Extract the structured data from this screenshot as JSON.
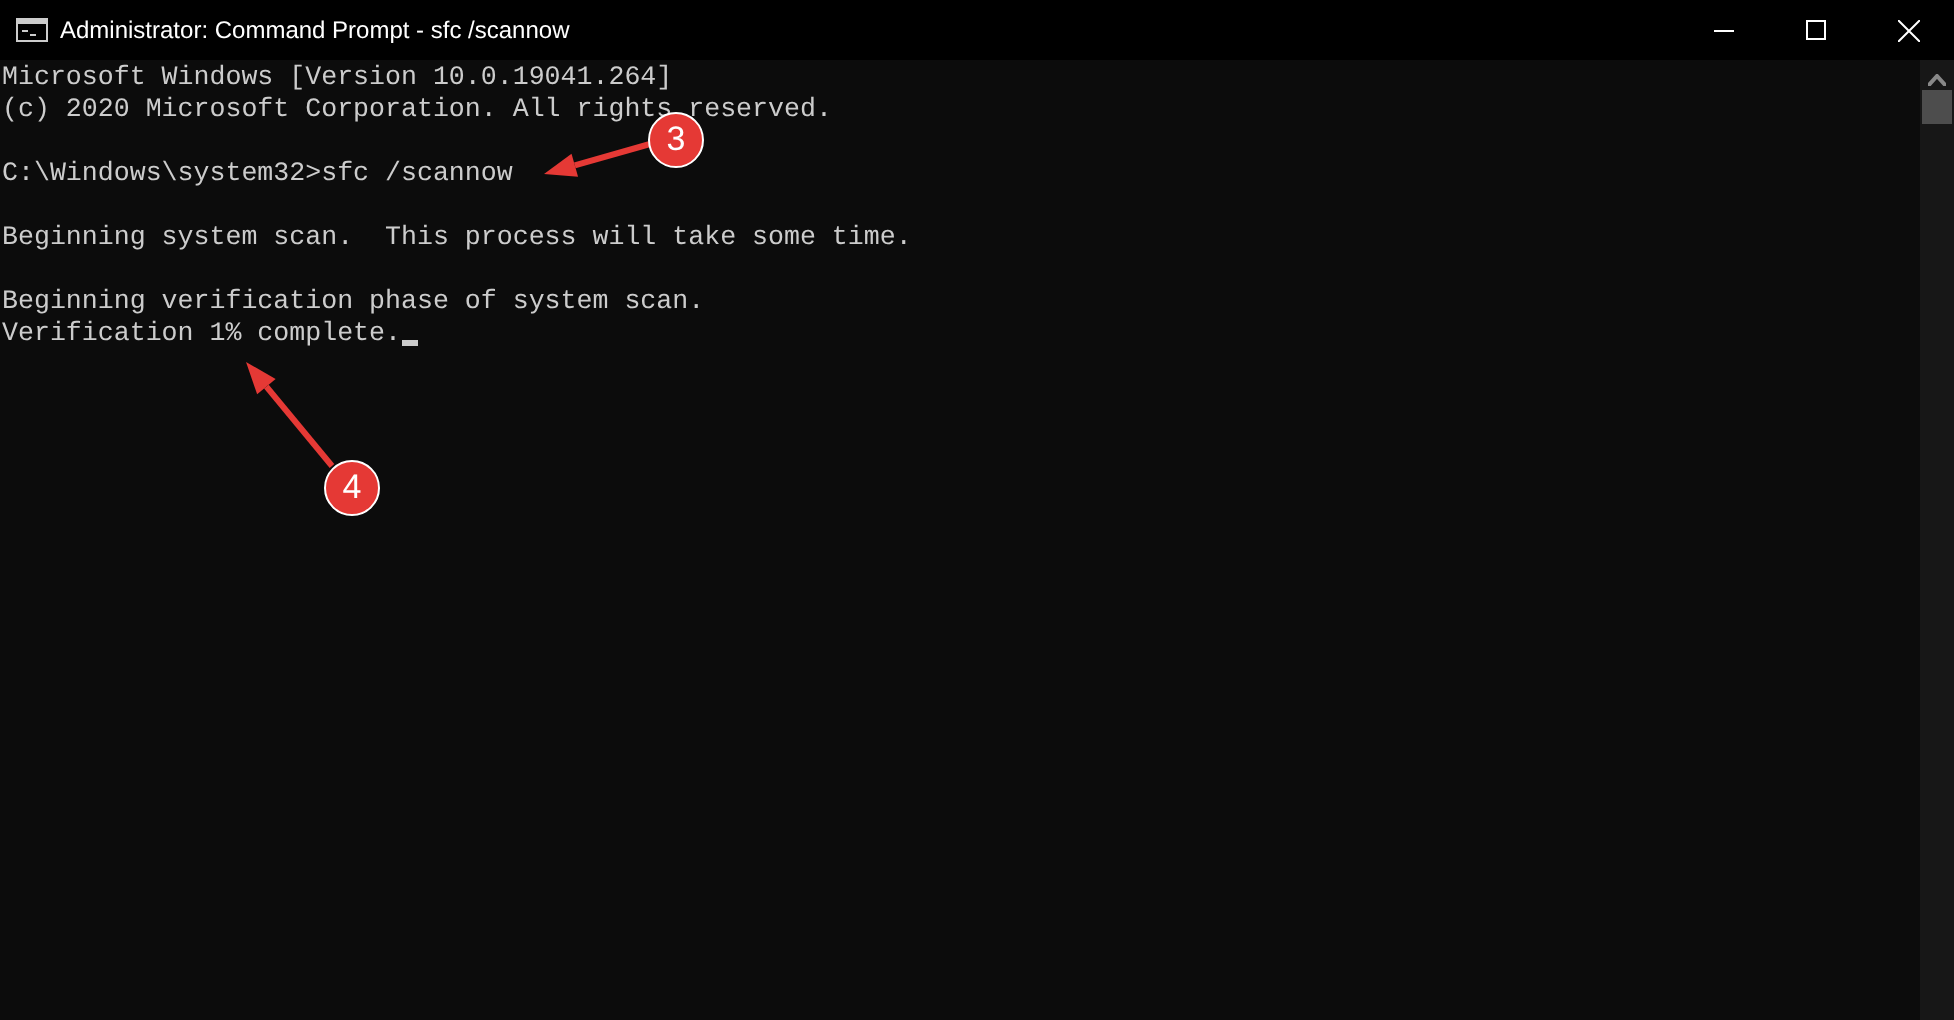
{
  "window": {
    "title": "Administrator: Command Prompt - sfc  /scannow"
  },
  "console": {
    "blocks": [
      {
        "lines": [
          {
            "text": "Microsoft Windows [Version 10.0.19041.264]",
            "cursor": false
          },
          {
            "text": "(c) 2020 Microsoft Corporation. All rights reserved.",
            "cursor": false
          }
        ]
      },
      {
        "lines": [
          {
            "text": "C:\\Windows\\system32>sfc /scannow",
            "cursor": false
          }
        ]
      },
      {
        "lines": [
          {
            "text": "Beginning system scan.  This process will take some time.",
            "cursor": false
          }
        ]
      },
      {
        "lines": [
          {
            "text": "Beginning verification phase of system scan.",
            "cursor": false
          },
          {
            "text": "Verification 1% complete.",
            "cursor": true
          }
        ]
      }
    ]
  },
  "annotations": [
    {
      "label": "3"
    },
    {
      "label": "4"
    }
  ]
}
